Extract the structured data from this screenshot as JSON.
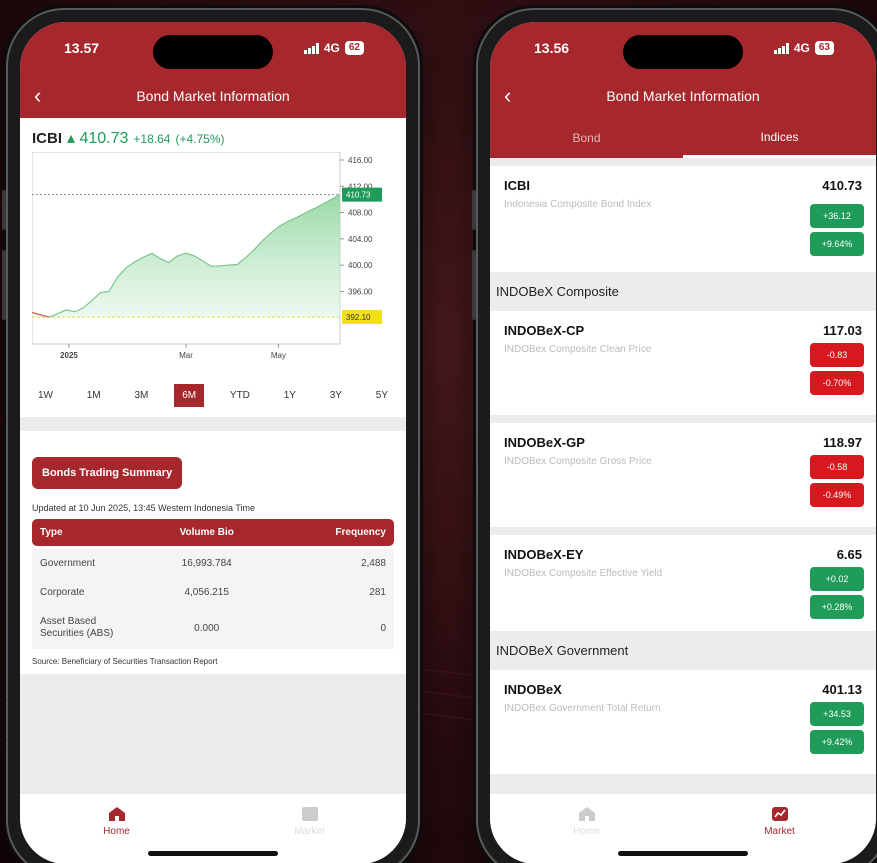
{
  "colors": {
    "brand": "#a6282c",
    "up": "#1f9c5a",
    "down": "#d8181f"
  },
  "left": {
    "status": {
      "time": "13.57",
      "network": "4G",
      "battery": "62"
    },
    "header": {
      "title": "Bond Market Information",
      "back_icon": "chevron-left-icon"
    },
    "ticker": {
      "symbol": "ICBI",
      "value": "410.73",
      "change": "+18.64",
      "pct": "(+4.75%)"
    },
    "chart_data": {
      "type": "area",
      "x_ticks": [
        "2025",
        "Mar",
        "May"
      ],
      "y_ticks": [
        "416.00",
        "412.00",
        "408.00",
        "404.00",
        "400.00",
        "396.00"
      ],
      "ylim": [
        388,
        416
      ],
      "last_label": "410.73",
      "low_label": "392.10",
      "values": [
        392.8,
        392.4,
        392.1,
        392.6,
        393.2,
        392.9,
        393.5,
        394.6,
        395.8,
        396.0,
        398.2,
        399.6,
        400.5,
        401.2,
        401.8,
        401.0,
        400.4,
        401.4,
        401.8,
        401.4,
        400.6,
        399.8,
        399.9,
        400.0,
        400.1,
        401.2,
        402.4,
        403.8,
        405.0,
        406.0,
        406.7,
        407.3,
        408.0,
        408.6,
        409.3,
        410.0,
        410.73
      ]
    },
    "ranges": [
      "1W",
      "1M",
      "3M",
      "6M",
      "YTD",
      "1Y",
      "3Y",
      "5Y"
    ],
    "active_range": "6M",
    "summary": {
      "button": "Bonds Trading Summary",
      "updated": "Updated at 10 Jun 2025, 13:45 Western Indonesia Time",
      "columns": [
        "Type",
        "Volume Bio",
        "Frequency"
      ],
      "rows": [
        [
          "Government",
          "16,993.784",
          "2,488"
        ],
        [
          "Corporate",
          "4,056.215",
          "281"
        ],
        [
          "Asset Based Securities (ABS)",
          "0.000",
          "0"
        ]
      ],
      "source": "Source: Beneficiary of Securities Transaction Report"
    },
    "bottom_nav": {
      "home": "Home",
      "second": "Market"
    }
  },
  "right": {
    "status": {
      "time": "13.56",
      "network": "4G",
      "battery": "63"
    },
    "header": {
      "title": "Bond Market Information"
    },
    "tabs": [
      "Bond",
      "Indices"
    ],
    "icbi": {
      "name": "ICBI",
      "desc": "Indonesia Composite Bond Index",
      "value": "410.73",
      "chg": "+36.12",
      "pct": "+9.64%"
    },
    "sections": {
      "composite": "INDOBeX Composite",
      "government": "INDOBeX Government"
    },
    "cp": {
      "name": "INDOBeX-CP",
      "desc": "INDOBex Composite Clean Price",
      "value": "117.03",
      "chg": "-0.83",
      "pct": "-0.70%"
    },
    "gp": {
      "name": "INDOBeX-GP",
      "desc": "INDOBex Composite Gross Price",
      "value": "118.97",
      "chg": "-0.58",
      "pct": "-0.49%"
    },
    "ey": {
      "name": "INDOBeX-EY",
      "desc": "INDOBex Composite Effective Yield",
      "value": "6.65",
      "chg": "+0.02",
      "pct": "+0.28%"
    },
    "gov": {
      "name": "INDOBeX",
      "desc": "INDOBex Government Total Return",
      "value": "401.13",
      "chg": "+34.53",
      "pct": "+9.42%"
    },
    "bottom_nav": {
      "home": "Home",
      "market": "Market"
    }
  }
}
